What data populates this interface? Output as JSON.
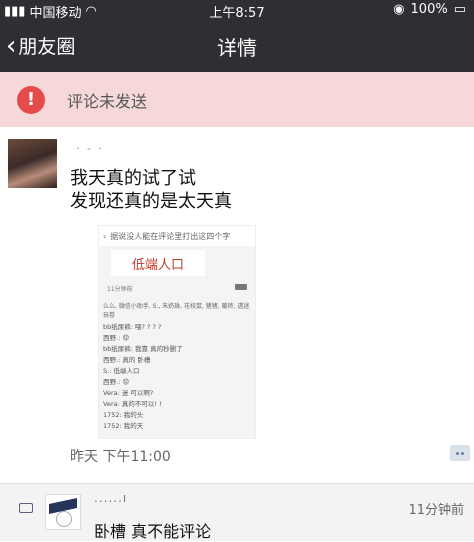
{
  "status_bar": {
    "carrier": "中国移动",
    "time": "上午8:57",
    "battery": "100%"
  },
  "nav": {
    "back_label": "朋友圈",
    "title": "详情"
  },
  "banner": {
    "icon": "alert-icon",
    "text": "评论未发送",
    "color": "#e64b4b"
  },
  "post": {
    "nickname": "· - ·",
    "text_line1": "我天真的试了试",
    "text_line2": "发现还真的是太天真",
    "photo": {
      "header": "据说没人能在评论里打出这四个字",
      "card_text": "低端人口",
      "time": "11分钟前",
      "likes": "么么, 微信小助手, S., 朱奶珠, 花校鼠, 猪猪, 暖砖, 透迷玩卷",
      "comments": [
        "bb纸尿裤: 喂? ? ? ?",
        "西野.: 😟",
        "bb纸尿裤: 我靠 真的秒删了",
        "西野.: 真的 卧槽",
        "S.: 低端人口",
        "西野.: 😟",
        "Vera: 迷 可以啊?",
        "Vera: 真的不可以! !",
        "1752: 我的头",
        "1752: 我的天"
      ]
    },
    "timestamp": "昨天 下午11:00"
  },
  "comment": {
    "name": "......ı",
    "text": "卧槽 真不能评论",
    "time": "11分钟前"
  }
}
